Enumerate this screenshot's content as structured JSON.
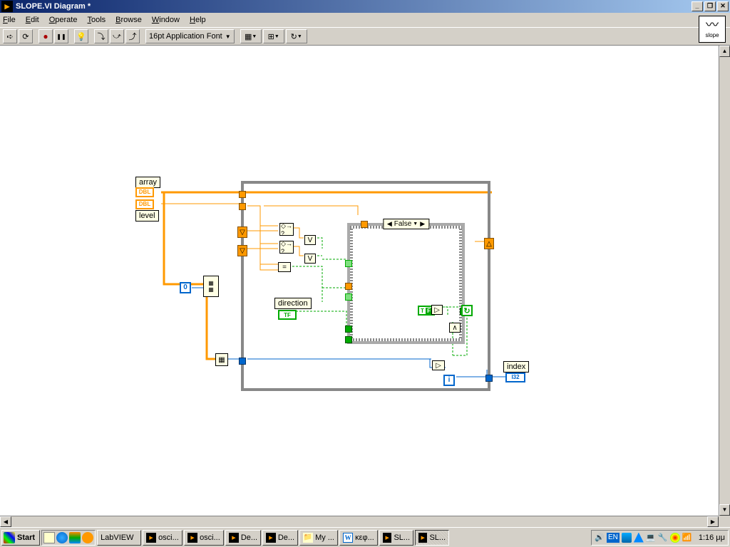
{
  "titlebar": {
    "title": "SLOPE.VI Diagram *"
  },
  "slope_label": "slope",
  "menu": {
    "file": "File",
    "edit": "Edit",
    "operate": "Operate",
    "tools": "Tools",
    "browse": "Browse",
    "window": "Window",
    "help": "Help"
  },
  "toolbar": {
    "font": "16pt Application Font"
  },
  "diagram": {
    "array_lbl": "array",
    "level_lbl": "level",
    "direction_lbl": "direction",
    "index_lbl": "index",
    "dbl": "DBL",
    "i32": "I32",
    "zero": "0",
    "case": {
      "value": "False"
    },
    "tf_const": "T F",
    "iter": "i"
  },
  "taskbar": {
    "start": "Start",
    "items": [
      "LabVIEW",
      "osci...",
      "osci...",
      "De...",
      "De...",
      "My ...",
      "κεφ...",
      "SL...",
      "SL..."
    ],
    "lang": "EN",
    "clock": "1:16 μμ"
  }
}
